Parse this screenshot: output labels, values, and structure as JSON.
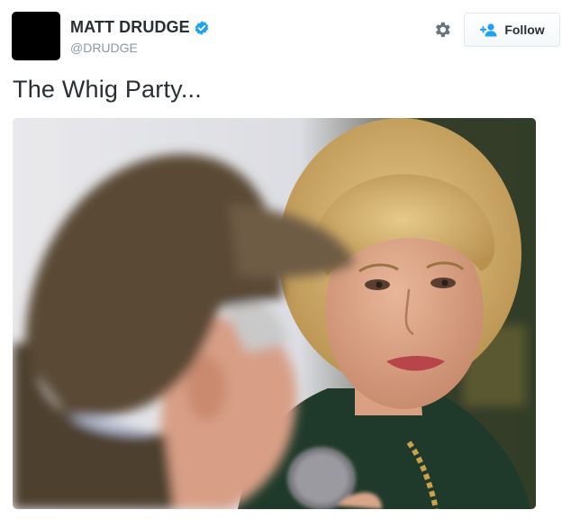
{
  "header": {
    "display_name": "MATT DRUDGE",
    "handle": "@DRUDGE",
    "verified_icon": "verified-badge-icon",
    "settings_icon": "gear-icon",
    "follow_label": "Follow",
    "follow_icon": "add-user-icon"
  },
  "tweet": {
    "text": "The Whig Party..."
  },
  "media": {
    "description_icon": "photo"
  },
  "colors": {
    "verified": "#1da1f2",
    "follow_icon": "#1da1f2",
    "handle": "#8899a6",
    "text": "#292f33"
  }
}
